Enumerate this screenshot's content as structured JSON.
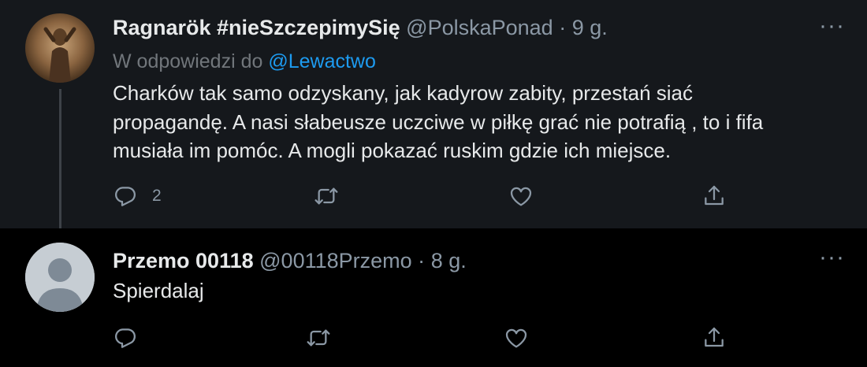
{
  "tweets": [
    {
      "name": "Ragnarök #nieSzczepimySię",
      "handle": "@PolskaPonad",
      "separator": "·",
      "time": "9 g.",
      "replying_prefix": "W odpowiedzi do",
      "replying_to": "@Lewactwo",
      "text_lines": [
        "Charków tak samo odzyskany, jak kadyrow zabity, przestań siać",
        "propagandę.  A nasi słabeusze uczciwe w piłkę grać nie potrafią , to i  fifa",
        "musiała im pomóc. A mogli pokazać ruskim gdzie ich miejsce."
      ],
      "reply_count": "2",
      "more": "···"
    },
    {
      "name": "Przemo 00118",
      "handle": "@00118Przemo",
      "separator": "·",
      "time": "8 g.",
      "text_lines": [
        "Spierdalaj"
      ],
      "more": "···"
    }
  ],
  "icons": {
    "reply": "reply-icon",
    "retweet": "retweet-icon",
    "like": "like-icon",
    "share": "share-icon",
    "more": "more-icon"
  },
  "colors": {
    "background_top": "#15181c",
    "background_bottom": "#000000",
    "accent": "#1d9bf0",
    "secondary_text": "#8b98a5"
  }
}
